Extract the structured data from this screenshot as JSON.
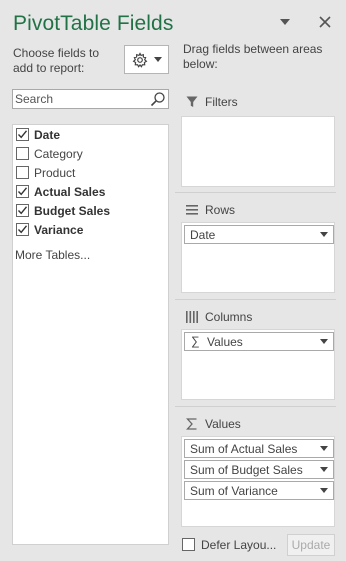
{
  "pane": {
    "title": "PivotTable Fields",
    "choose_label": "Choose fields to add to report:",
    "drag_label": "Drag fields between areas below:"
  },
  "search": {
    "placeholder": "Search"
  },
  "fields": [
    {
      "label": "Date",
      "checked": true
    },
    {
      "label": "Category",
      "checked": false
    },
    {
      "label": "Product",
      "checked": false
    },
    {
      "label": "Actual Sales",
      "checked": true
    },
    {
      "label": "Budget Sales",
      "checked": true
    },
    {
      "label": "Variance",
      "checked": true
    }
  ],
  "more_tables": "More Tables...",
  "areas": {
    "filters": {
      "label": "Filters",
      "icon": "funnel-icon"
    },
    "rows": {
      "label": "Rows",
      "icon": "rows-icon",
      "items": [
        "Date"
      ]
    },
    "columns": {
      "label": "Columns",
      "icon": "columns-icon",
      "items": [
        "Values"
      ]
    },
    "values": {
      "label": "Values",
      "icon": "sigma-icon",
      "items": [
        "Sum of Actual Sales",
        "Sum of Budget Sales",
        "Sum of Variance"
      ]
    }
  },
  "footer": {
    "defer_label": "Defer Layou...",
    "update_label": "Update"
  },
  "colors": {
    "title": "#217346",
    "background": "#e6e6e6"
  }
}
